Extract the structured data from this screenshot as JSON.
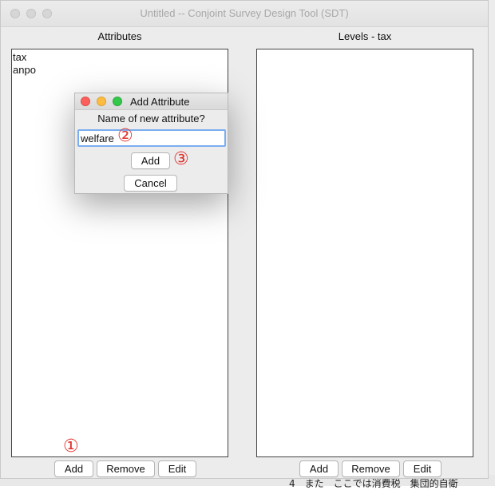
{
  "window": {
    "title": "Untitled -- Conjoint Survey Design Tool (SDT)"
  },
  "attributes_panel": {
    "title": "Attributes",
    "items": [
      "tax",
      "anpo"
    ],
    "buttons": {
      "add": "Add",
      "remove": "Remove",
      "edit": "Edit"
    }
  },
  "levels_panel": {
    "title": "Levels - tax",
    "items": [],
    "buttons": {
      "add": "Add",
      "remove": "Remove",
      "edit": "Edit"
    }
  },
  "dialog": {
    "title": "Add Attribute",
    "prompt": "Name of new attribute?",
    "input_value": "welfare",
    "add_label": "Add",
    "cancel_label": "Cancel"
  },
  "annotations": {
    "step1": "①",
    "step2": "②",
    "step3": "③"
  },
  "background_document": {
    "bottom_text": "4　また　ここでは消費税　集団的自衛"
  },
  "colors": {
    "annotation_red": "#e0342f",
    "close": "#fc605c",
    "minimize": "#fdbc40",
    "zoom": "#34c84a",
    "focus_ring": "#7aaef0"
  }
}
